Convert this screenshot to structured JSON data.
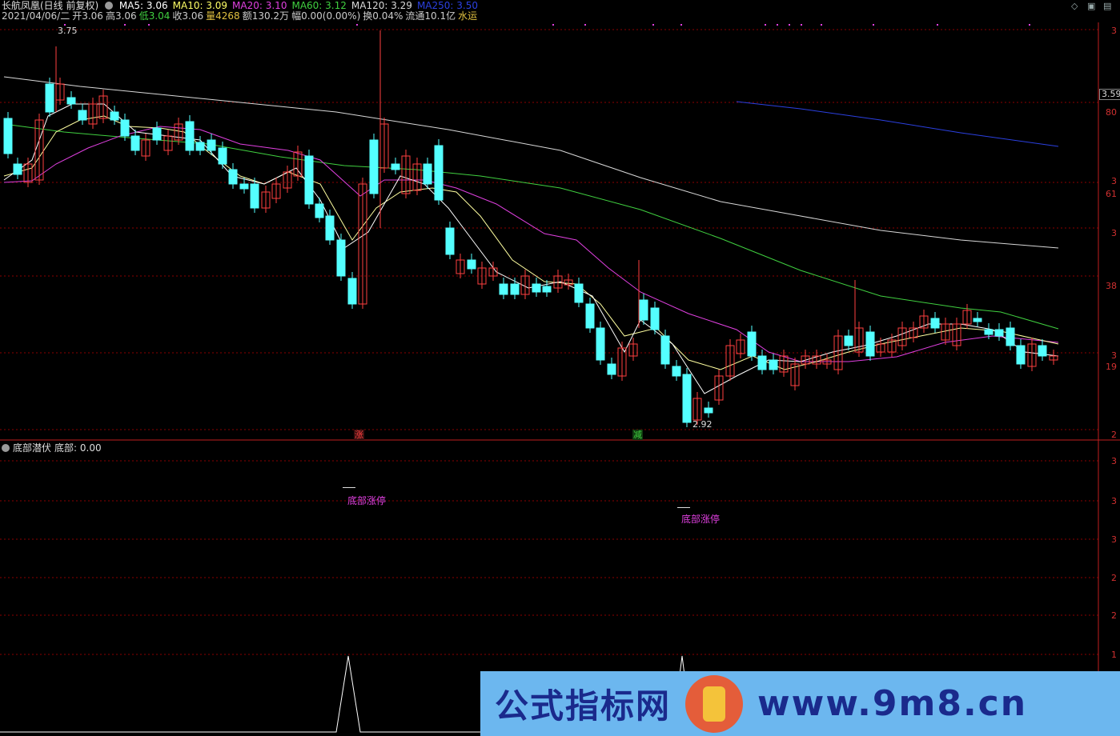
{
  "header": {
    "stock_name": "长航凤凰(日线 前复权)",
    "ma_labels": [
      {
        "text": "MA5: 3.06",
        "color": "#ffffff"
      },
      {
        "text": "MA10: 3.09",
        "color": "#ffff66"
      },
      {
        "text": "MA20: 3.10",
        "color": "#e040e0"
      },
      {
        "text": "MA60: 3.12",
        "color": "#40d040"
      },
      {
        "text": "MA120: 3.29",
        "color": "#d8d8d8"
      },
      {
        "text": "MA250: 3.50",
        "color": "#2b40e0"
      }
    ],
    "quote_items": [
      {
        "text": "2021/04/06/二",
        "color": "#cccccc"
      },
      {
        "text": "开3.06",
        "color": "#cccccc"
      },
      {
        "text": "高3.06",
        "color": "#cccccc"
      },
      {
        "text": "低3.04",
        "color": "#40d040"
      },
      {
        "text": "收3.06",
        "color": "#cccccc"
      },
      {
        "text": "量4268",
        "color": "#e0c040"
      },
      {
        "text": "额130.2万",
        "color": "#cccccc"
      },
      {
        "text": "幅0.00(0.00%)",
        "color": "#cccccc"
      },
      {
        "text": "换0.04%",
        "color": "#cccccc"
      },
      {
        "text": "流通10.1亿",
        "color": "#cccccc"
      },
      {
        "text": "水运",
        "color": "#e0c040"
      }
    ]
  },
  "price_panel": {
    "high_label": "3.75",
    "low_label": "2.92",
    "current_price_tag": "3.59",
    "axis_labels": [
      "3",
      "3.59",
      "80",
      "3",
      "61",
      "3",
      "38",
      "3",
      "19",
      "2"
    ],
    "event_markers": [
      {
        "text": "涨",
        "color": "#ff4040"
      },
      {
        "text": "减",
        "color": "#40d040"
      }
    ]
  },
  "indicator_panel": {
    "title": "底部潜伏",
    "value_label": "底部: 0.00",
    "annotations": [
      "底部涨停",
      "底部涨停"
    ],
    "axis_labels": [
      "3",
      "3",
      "3",
      "2",
      "2",
      "1"
    ]
  },
  "watermark": {
    "left_text": "公式指标网",
    "right_text": "www.9m8.cn"
  },
  "colors": {
    "up": "#ff4040",
    "down": "#54ffff",
    "grid": "#8b0000",
    "separator": "#c02020"
  }
}
